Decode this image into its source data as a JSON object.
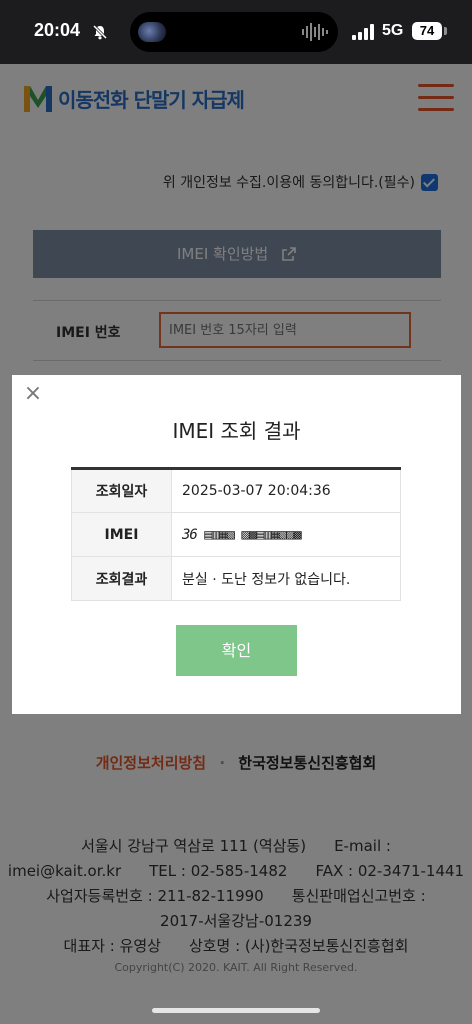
{
  "status_bar": {
    "time": "20:04",
    "network": "5G",
    "battery": "74"
  },
  "header": {
    "logo_text": "이동전화 단말기 자급제"
  },
  "form": {
    "consent_text": "위 개인정보 수집.이용에 동의합니다.(필수)",
    "imei_guide_label": "IMEI 확인방법",
    "imei_label": "IMEI 번호",
    "imei_placeholder": "IMEI 번호 15자리 입력"
  },
  "modal": {
    "title": "IMEI 조회 결과",
    "rows": [
      {
        "label": "조회일자",
        "value": "2025-03-07 20:04:36"
      },
      {
        "label": "IMEI",
        "value": "36 ▤▥▦▧ ▨▩▤▥▦▧▨▩"
      },
      {
        "label": "조회결과",
        "value": "분실 · 도난 정보가 없습니다."
      }
    ],
    "confirm_label": "확인"
  },
  "footer": {
    "privacy_link": "개인정보처리방침",
    "separator": "·",
    "org_name": "한국정보통신진흥협회",
    "address": "서울시 강남구 역삼로 111 (역삼동)",
    "email_label": "E-mail :",
    "email": "imei@kait.or.kr",
    "tel": "TEL : 02-585-1482",
    "fax": "FAX : 02-3471-1441",
    "business_no": "사업자등록번호 : 211-82-11990",
    "telecom_sales_label": "통신판매업신고번호 :",
    "telecom_sales_no": "2017-서울강남-01239",
    "ceo": "대표자 : 유영상",
    "company": "상호명 : (사)한국정보통신진흥협회",
    "copyright": "Copyright(C) 2020. KAIT. All Right Reserved."
  },
  "colors": {
    "accent_orange": "#e9562b",
    "confirm_green": "#7ec68a",
    "guide_button": "#7f8fa6",
    "check_blue": "#1f6fe0"
  }
}
